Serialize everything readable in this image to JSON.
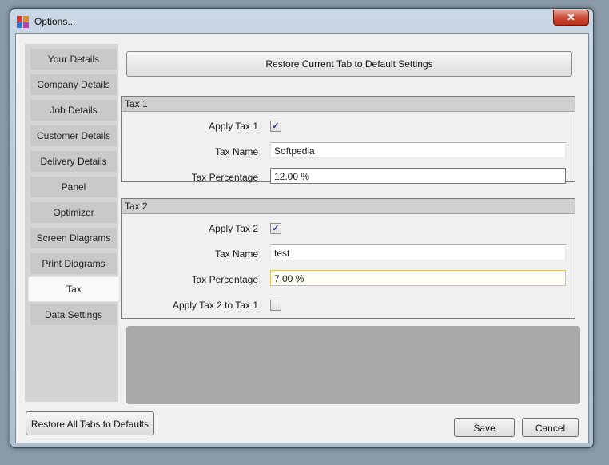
{
  "window": {
    "title": "Options..."
  },
  "sidebar": {
    "items": [
      {
        "label": "Your Details"
      },
      {
        "label": "Company Details"
      },
      {
        "label": "Job Details"
      },
      {
        "label": "Customer Details"
      },
      {
        "label": "Delivery Details"
      },
      {
        "label": "Panel"
      },
      {
        "label": "Optimizer"
      },
      {
        "label": "Screen Diagrams"
      },
      {
        "label": "Print Diagrams"
      },
      {
        "label": "Tax",
        "selected": true
      },
      {
        "label": "Data Settings"
      }
    ]
  },
  "main": {
    "restore_tab_label": "Restore Current Tab to Default Settings",
    "tax1": {
      "header": "Tax 1",
      "apply_label": "Apply Tax 1",
      "apply_checked": true,
      "name_label": "Tax Name",
      "name_value": "Softpedia",
      "percentage_label": "Tax Percentage",
      "percentage_value": "12.00 %"
    },
    "tax2": {
      "header": "Tax 2",
      "apply_label": "Apply Tax 2",
      "apply_checked": true,
      "name_label": "Tax Name",
      "name_value": "test",
      "percentage_label": "Tax Percentage",
      "percentage_value": "7.00 %",
      "apply_to_tax1_label": "Apply Tax 2 to Tax 1",
      "apply_to_tax1_checked": false
    }
  },
  "footer": {
    "restore_all_label": "Restore All Tabs to Defaults",
    "save_label": "Save",
    "cancel_label": "Cancel"
  },
  "icons": {
    "close": "close-icon",
    "app": "app-icon",
    "check": "checkmark-icon"
  }
}
